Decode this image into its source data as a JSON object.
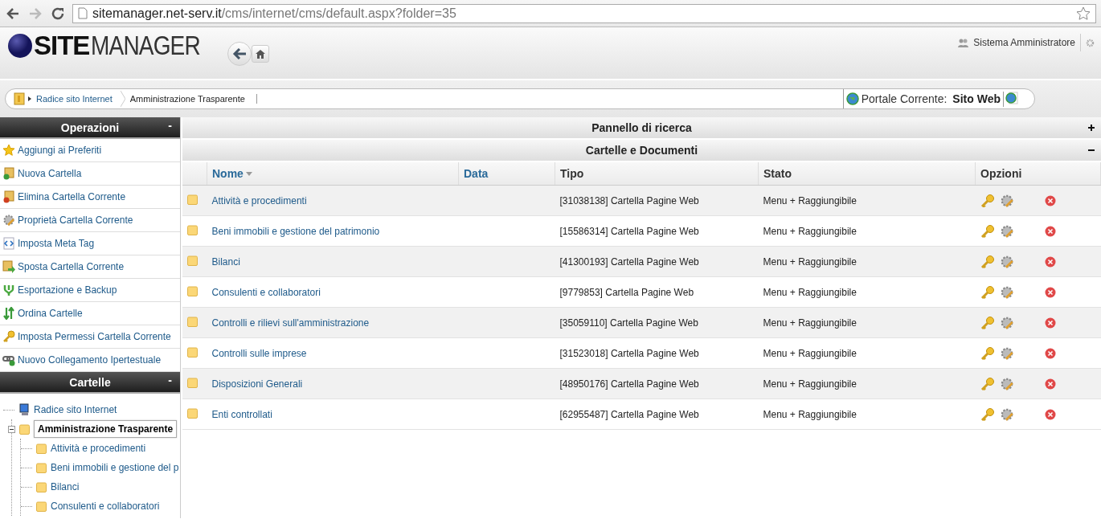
{
  "browser": {
    "url_host": "sitemanager.net-serv.it",
    "url_path": "/cms/internet/cms/default.aspx?folder=35"
  },
  "header": {
    "logo_bold": "SITE",
    "logo_light": "MANAGER",
    "user": "Sistema Amministratore"
  },
  "breadcrumb": {
    "items": [
      "Radice sito Internet",
      "Amministrazione Trasparente"
    ],
    "portal_label": "Portale Corrente:",
    "portal_value": "Sito Web"
  },
  "operations": {
    "title": "Operazioni",
    "toggle": "-",
    "items": [
      {
        "label": "Aggiungi ai Preferiti"
      },
      {
        "label": "Nuova Cartella"
      },
      {
        "label": "Elimina Cartella Corrente"
      },
      {
        "label": "Proprietà Cartella Corrente"
      },
      {
        "label": "Imposta Meta Tag"
      },
      {
        "label": "Sposta Cartella Corrente"
      },
      {
        "label": "Esportazione e Backup"
      },
      {
        "label": "Ordina Cartelle"
      },
      {
        "label": "Imposta Permessi Cartella Corrente"
      },
      {
        "label": "Nuovo Collegamento Ipertestuale"
      }
    ]
  },
  "folders": {
    "title": "Cartelle",
    "toggle": "-",
    "tree": [
      {
        "label": "Radice sito Internet",
        "kind": "site",
        "selected": false,
        "expanded": true,
        "children": [
          {
            "label": "Amministrazione Trasparente",
            "kind": "folder",
            "selected": true,
            "expanded": true,
            "children": [
              {
                "label": "Attività e procedimenti",
                "kind": "folder",
                "selected": false
              },
              {
                "label": "Beni immobili e gestione del p",
                "kind": "folder",
                "selected": false
              },
              {
                "label": "Bilanci",
                "kind": "folder",
                "selected": false
              },
              {
                "label": "Consulenti e collaboratori",
                "kind": "folder",
                "selected": false
              }
            ]
          }
        ]
      }
    ]
  },
  "panels": [
    {
      "title": "Pannello di ricerca",
      "expanded": false
    },
    {
      "title": "Cartelle e Documenti",
      "expanded": true
    }
  ],
  "table": {
    "columns": [
      {
        "label": "Nome",
        "sorted": true
      },
      {
        "label": "Data",
        "sorted": false
      },
      {
        "label": "Tipo",
        "sorted": false
      },
      {
        "label": "Stato",
        "sorted": false
      },
      {
        "label": "Opzioni",
        "sorted": false
      }
    ],
    "rows": [
      {
        "name": "Attività e procedimenti",
        "tipo": "[31038138] Cartella Pagine Web",
        "stato": "Menu + Raggiungibile"
      },
      {
        "name": "Beni immobili e gestione del patrimonio",
        "tipo": "[15586314] Cartella Pagine Web",
        "stato": "Menu + Raggiungibile"
      },
      {
        "name": "Bilanci",
        "tipo": "[41300193] Cartella Pagine Web",
        "stato": "Menu + Raggiungibile"
      },
      {
        "name": "Consulenti e collaboratori",
        "tipo": "[9779853] Cartella Pagine Web",
        "stato": "Menu + Raggiungibile"
      },
      {
        "name": "Controlli e rilievi sull'amministrazione",
        "tipo": "[35059110] Cartella Pagine Web",
        "stato": "Menu + Raggiungibile"
      },
      {
        "name": "Controlli sulle imprese",
        "tipo": "[31523018] Cartella Pagine Web",
        "stato": "Menu + Raggiungibile"
      },
      {
        "name": "Disposizioni Generali",
        "tipo": "[48950176] Cartella Pagine Web",
        "stato": "Menu + Raggiungibile"
      },
      {
        "name": "Enti controllati",
        "tipo": "[62955487] Cartella Pagine Web",
        "stato": "Menu + Raggiungibile"
      }
    ]
  }
}
